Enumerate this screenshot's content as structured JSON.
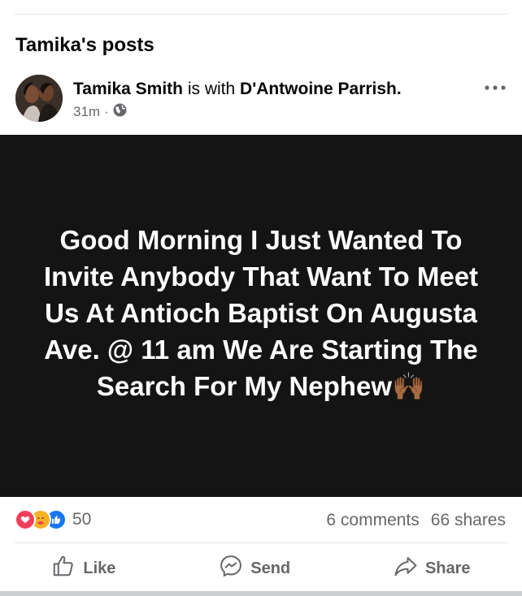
{
  "section": {
    "title": "Tamika's posts"
  },
  "post": {
    "author": "Tamika Smith",
    "with_text": "is with",
    "tagged": "D'Antwoine Parrish.",
    "time": "31m",
    "separator": "·",
    "privacy_icon": "globe-icon",
    "more_icon": "more-options-icon",
    "image_text": "Good Morning I Just Wanted To Invite Anybody That Want To Meet Us At Antioch Baptist On Augusta Ave. @ 11 am We Are Starting The Search For My Nephew",
    "image_emoji": "🙌🏾"
  },
  "engagement": {
    "reaction_icons": [
      "love-icon",
      "care-icon",
      "like-icon"
    ],
    "reaction_count": "50",
    "comments": "6 comments",
    "shares": "66 shares"
  },
  "actions": {
    "like": "Like",
    "send": "Send",
    "share": "Share"
  },
  "colors": {
    "image_background": "#141414",
    "like_blue": "#1877f2",
    "love_red": "#f33e58",
    "care_yellow": "#f7b125",
    "secondary_text": "#65676b"
  }
}
